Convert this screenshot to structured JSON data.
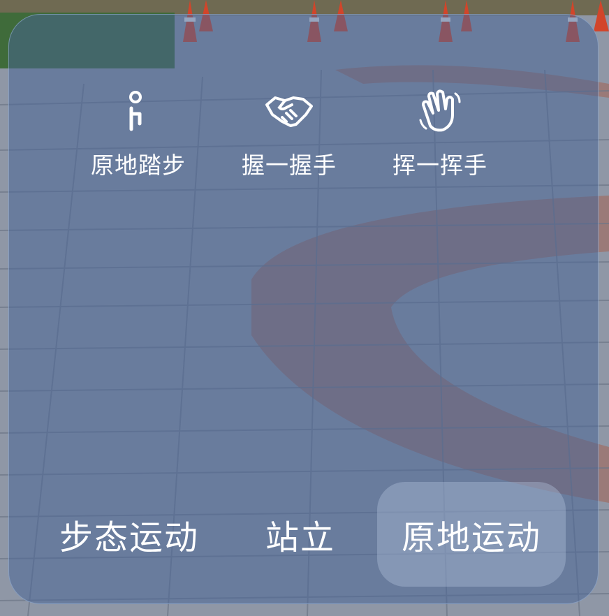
{
  "actions": [
    {
      "label": "原地踏步",
      "icon": "marching-person-icon"
    },
    {
      "label": "握一握手",
      "icon": "handshake-icon"
    },
    {
      "label": "挥一挥手",
      "icon": "waving-hand-icon"
    }
  ],
  "modes": [
    {
      "label": "步态运动",
      "selected": false
    },
    {
      "label": "站立",
      "selected": false
    },
    {
      "label": "原地运动",
      "selected": true
    }
  ],
  "colors": {
    "panel": "#46649a",
    "text": "#ffffff",
    "selected_mode": "#b4c3dc"
  }
}
